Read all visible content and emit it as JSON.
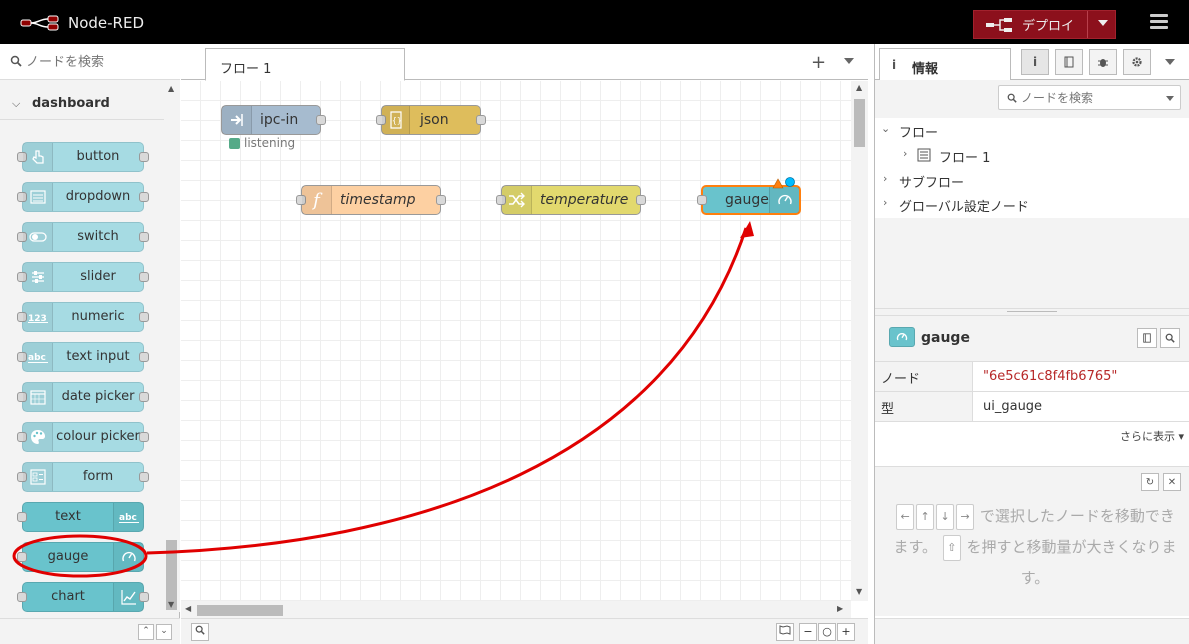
{
  "header": {
    "app_name": "Node-RED",
    "deploy_label": "デプロイ"
  },
  "palette": {
    "search_placeholder": "ノードを検索",
    "category": "dashboard",
    "nodes": [
      {
        "label": "button",
        "icon": "hand-pointer-icon"
      },
      {
        "label": "dropdown",
        "icon": "list-icon"
      },
      {
        "label": "switch",
        "icon": "toggle-icon"
      },
      {
        "label": "slider",
        "icon": "sliders-icon"
      },
      {
        "label": "numeric",
        "icon": "numeric-123-icon"
      },
      {
        "label": "text input",
        "icon": "text-abc-icon"
      },
      {
        "label": "date picker",
        "icon": "calendar-icon"
      },
      {
        "label": "colour picker",
        "icon": "palette-icon"
      },
      {
        "label": "form",
        "icon": "form-icon"
      },
      {
        "label": "text",
        "icon": "text-abc-icon"
      },
      {
        "label": "gauge",
        "icon": "gauge-icon"
      },
      {
        "label": "chart",
        "icon": "chart-line-icon"
      }
    ]
  },
  "workspace": {
    "tab_label": "フロー 1",
    "nodes": {
      "ipc_in": {
        "label": "ipc-in",
        "status": "listening",
        "color": "#a6bbcf"
      },
      "json": {
        "label": "json",
        "color": "#debd5c"
      },
      "timestamp": {
        "label": "timestamp",
        "color": "#fdd0a2"
      },
      "temperature": {
        "label": "temperature",
        "color": "#e2d96e"
      },
      "gauge": {
        "label": "gauge",
        "color": "#69c3cc"
      }
    }
  },
  "sidebar": {
    "tab_label": "情報",
    "search_placeholder": "ノードを検索",
    "tree": {
      "flows": "フロー",
      "flow1": "フロー 1",
      "subflows": "サブフロー",
      "global_config": "グローバル設定ノード"
    },
    "node_info": {
      "name": "gauge",
      "rows": [
        {
          "key": "ノード",
          "value": "\"6e5c61c8f4fb6765\""
        },
        {
          "key": "型",
          "value": "ui_gauge"
        }
      ],
      "more": "さらに表示"
    },
    "help": {
      "text_part1": "で選択したノードを移動できます。",
      "text_part2": "を押すと移動量が大きくなります。"
    }
  },
  "colors": {
    "header_bg": "#000000",
    "deploy_bg": "#8c101c",
    "dashboard_node": "#a6dbe3",
    "dashboard_node_dark": "#69c3cc",
    "selected_border": "#ff7f0e",
    "annotation_red": "#e00000"
  }
}
